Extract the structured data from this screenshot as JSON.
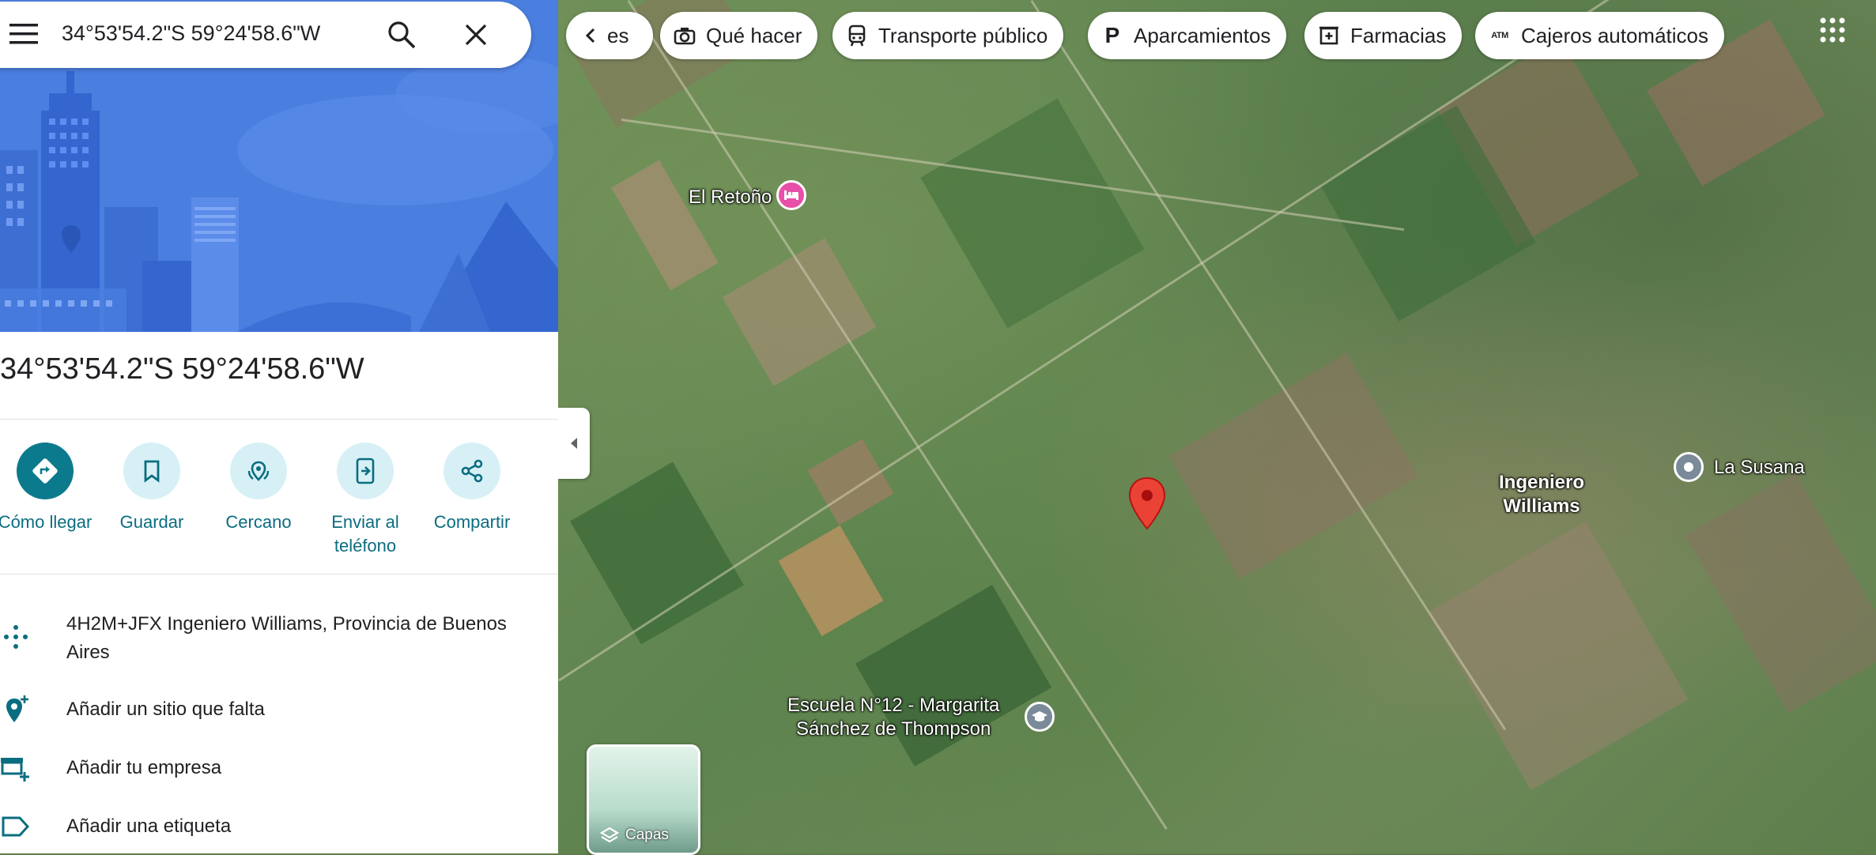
{
  "search": {
    "query": "34°53'54.2\"S 59°24'58.6\"W"
  },
  "place": {
    "title": "34°53'54.2\"S 59°24'58.6\"W"
  },
  "actions": [
    {
      "label": "Cómo llegar",
      "icon": "directions-icon"
    },
    {
      "label": "Guardar",
      "icon": "bookmark-icon"
    },
    {
      "label": "Cercano",
      "icon": "nearby-icon"
    },
    {
      "label": "Enviar al teléfono",
      "icon": "send-to-phone-icon"
    },
    {
      "label": "Compartir",
      "icon": "share-icon"
    }
  ],
  "info": [
    {
      "text": "4H2M+JFX Ingeniero Williams, Provincia de Buenos Aires",
      "icon": "plus-code-icon"
    },
    {
      "text": "Añadir un sitio que falta",
      "icon": "add-place-icon"
    },
    {
      "text": "Añadir tu empresa",
      "icon": "add-business-icon"
    },
    {
      "text": "Añadir una etiqueta",
      "icon": "label-icon"
    }
  ],
  "chips": [
    {
      "label": "es",
      "icon": "back-chevron-icon"
    },
    {
      "label": "Qué hacer",
      "icon": "camera-icon"
    },
    {
      "label": "Transporte público",
      "icon": "transit-icon"
    },
    {
      "label": "Aparcamientos",
      "icon": "parking-icon"
    },
    {
      "label": "Farmacias",
      "icon": "pharmacy-icon"
    },
    {
      "label": "Cajeros automáticos",
      "icon": "atm-icon"
    }
  ],
  "map_labels": {
    "el_retono": "El Retoño",
    "ingeniero_williams": "Ingeniero\nWilliams",
    "la_susana": "La Susana",
    "escuela": "Escuela N°12 - Margarita\nSánchez de Thompson"
  },
  "layers": {
    "label": "Capas"
  },
  "colors": {
    "accent": "#0b7a8c",
    "pin": "#ea4335",
    "chip_bg": "#ffffff",
    "hero": "#4a7fe0",
    "hotel_pin": "#e84fa8"
  }
}
